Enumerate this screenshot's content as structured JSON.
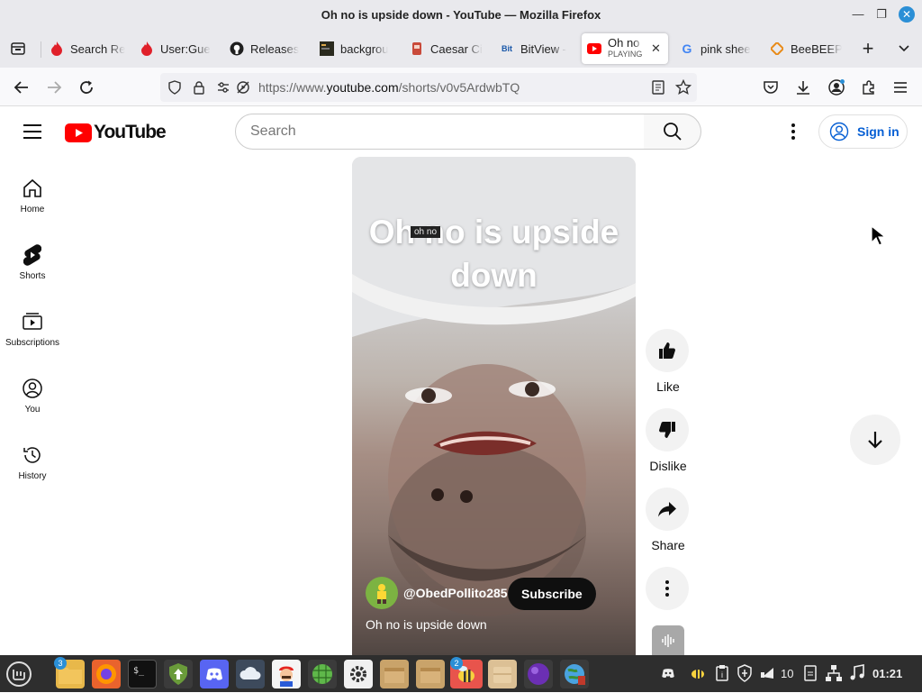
{
  "window": {
    "title": "Oh no is upside down - YouTube — Mozilla Firefox"
  },
  "tabs": [
    {
      "label": "Search Re",
      "icon": "fire-icon"
    },
    {
      "label": "User:Gue",
      "icon": "fire-icon"
    },
    {
      "label": "Releases",
      "icon": "github-icon"
    },
    {
      "label": "backgrou",
      "icon": "terminal-icon"
    },
    {
      "label": "Caesar Ci",
      "icon": "cipher-icon"
    },
    {
      "label": "BitView -",
      "icon": "bitview-icon"
    },
    {
      "label": "Oh no",
      "sublabel": "PLAYING",
      "icon": "youtube-icon",
      "active": true
    },
    {
      "label": "pink shee",
      "icon": "google-icon"
    },
    {
      "label": "BeeBEEP",
      "icon": "beebeep-icon"
    }
  ],
  "navbar": {
    "url_prefix": "https://www.",
    "url_domain": "youtube.com",
    "url_path": "/shorts/v0v5ArdwbTQ"
  },
  "youtube": {
    "logo_text": "YouTube",
    "search_placeholder": "Search",
    "sign_in": "Sign in",
    "sidebar": [
      {
        "label": "Home",
        "icon": "home-icon"
      },
      {
        "label": "Shorts",
        "icon": "shorts-icon"
      },
      {
        "label": "Subscriptions",
        "icon": "subscriptions-icon"
      },
      {
        "label": "You",
        "icon": "you-icon"
      },
      {
        "label": "History",
        "icon": "history-icon"
      }
    ],
    "short": {
      "overlay_title": "Oh no is upside down",
      "tooltip": "oh no",
      "channel": "@ObedPollito285",
      "subscribe": "Subscribe",
      "caption": "Oh no is upside down"
    },
    "actions": {
      "like": "Like",
      "dislike": "Dislike",
      "share": "Share"
    }
  },
  "taskbar": {
    "files_badge": "3",
    "beebeep_badge": "2",
    "volume": "10",
    "clock": "01:21"
  },
  "colors": {
    "youtube_red": "#ff0000",
    "link_blue": "#065fd4",
    "firefox_close": "#2b8fd6"
  }
}
